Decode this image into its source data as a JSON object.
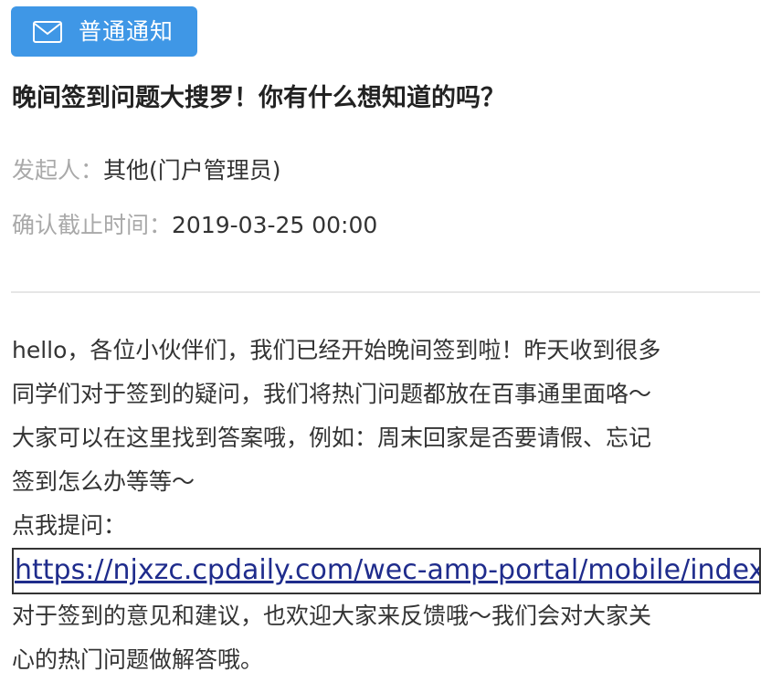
{
  "badge": {
    "icon": "envelope-icon",
    "label": "普通通知"
  },
  "title": "晚间签到问题大搜罗！你有什么想知道的吗？",
  "meta": {
    "initiator_key": "发起人：",
    "initiator_value": "其他(门户管理员)",
    "deadline_key": "确认截止时间：",
    "deadline_value": "2019-03-25 00:00"
  },
  "body": {
    "lines": [
      "hello，各位小伙伴们，我们已经开始晚间签到啦！昨天收到很多",
      "同学们对于签到的疑问，我们将热门问题都放在百事通里面咯～",
      "大家可以在这里找到答案哦，例如：周末回家是否要请假、忘记",
      "签到怎么办等等～",
      "点我提问："
    ],
    "link": "https://njxzc.cpdaily.com/wec-amp-portal/mobile/index",
    "after_lines": [
      "对于签到的意见和建议，也欢迎大家来反馈哦～我们会对大家关",
      "心的热门问题做解答哦。"
    ]
  },
  "colors": {
    "badge_bg": "#3f97e6",
    "muted_label": "#a9a9a9",
    "text": "#333333",
    "link": "#1f2c8c"
  }
}
